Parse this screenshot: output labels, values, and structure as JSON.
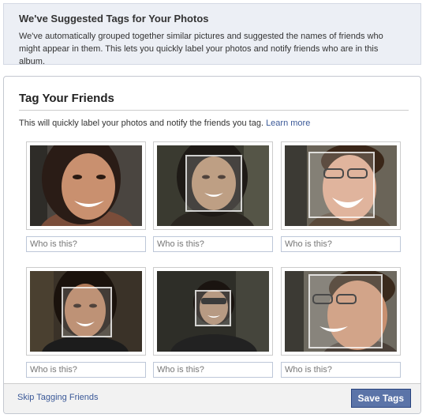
{
  "notice": {
    "title": "We've Suggested Tags for Your Photos",
    "text": "We've automatically grouped together similar pictures and suggested the names of friends who might appear in them. This lets you quickly label your photos and notify friends who are in this album."
  },
  "dialog": {
    "title": "Tag Your Friends",
    "intro": "This will quickly label your photos and notify the friends you tag.",
    "learn_more": "Learn more"
  },
  "photos": [
    {
      "placeholder": "Who is this?"
    },
    {
      "placeholder": "Who is this?"
    },
    {
      "placeholder": "Who is this?"
    },
    {
      "placeholder": "Who is this?"
    },
    {
      "placeholder": "Who is this?"
    },
    {
      "placeholder": "Who is this?"
    }
  ],
  "footer": {
    "skip_label": "Skip Tagging Friends",
    "save_label": "Save Tags"
  },
  "colors": {
    "link": "#3b5998",
    "button": "#5b74a8",
    "notice_bg": "#eceff5"
  }
}
